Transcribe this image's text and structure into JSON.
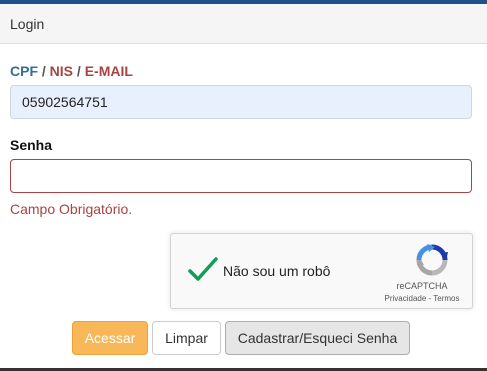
{
  "panel": {
    "title": "Login"
  },
  "form": {
    "user_label": {
      "cpf": "CPF",
      "sep1": " / ",
      "nis": "NIS",
      "sep2": " / ",
      "email": "E-MAIL"
    },
    "user_value": "05902564751",
    "password_label": "Senha",
    "password_value": "",
    "password_error": "Campo Obrigatório."
  },
  "recaptcha": {
    "label": "Não sou um robô",
    "checked": true,
    "brand": "reCAPTCHA",
    "privacy": "Privacidade",
    "links_sep": " - ",
    "terms": "Termos",
    "check_icon": "checkmark-icon",
    "logo_icon": "recaptcha-logo-icon"
  },
  "buttons": {
    "acessar": "Acessar",
    "limpar": "Limpar",
    "cadastrar": "Cadastrar/Esqueci Senha"
  },
  "colors": {
    "accent_blue": "#31708f",
    "error_red": "#a94442",
    "primary_orange": "#f8b85a",
    "check_green": "#0f9d58"
  }
}
